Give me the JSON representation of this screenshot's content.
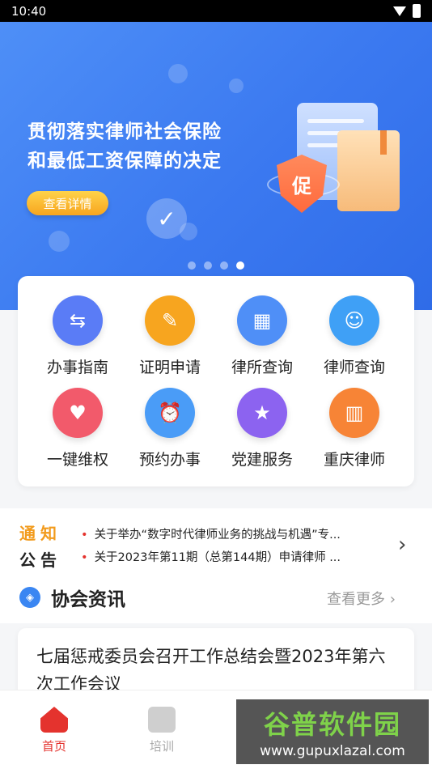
{
  "status": {
    "time": "10:40"
  },
  "banner": {
    "title_line1": "贯彻落实律师社会保险",
    "title_line2": "和最低工资保障的决定",
    "button": "查看详情",
    "shield_char": "促",
    "dots": 4,
    "active_dot": 4
  },
  "grid": [
    {
      "label": "办事指南",
      "icon": "signpost-icon",
      "color": "#5a7cf6"
    },
    {
      "label": "证明申请",
      "icon": "clipboard-edit-icon",
      "color": "#f7a51f"
    },
    {
      "label": "律所查询",
      "icon": "building-search-icon",
      "color": "#4f8ff7"
    },
    {
      "label": "律师查询",
      "icon": "person-search-icon",
      "color": "#3fa0f6"
    },
    {
      "label": "一键维权",
      "icon": "badge-shield-icon",
      "color": "#f25a6b"
    },
    {
      "label": "预约办事",
      "icon": "alarm-clock-icon",
      "color": "#4a9cf7"
    },
    {
      "label": "党建服务",
      "icon": "party-book-icon",
      "color": "#8c63f0"
    },
    {
      "label": "重庆律师",
      "icon": "columns-icon",
      "color": "#f78436"
    }
  ],
  "notice": {
    "logo_top": "通知",
    "logo_bottom": "公告",
    "items": [
      "关于举办“数字时代律师业务的挑战与机遇”专...",
      "关于2023年第11期（总第144期）申请律师 ..."
    ]
  },
  "section": {
    "title": "协会资讯",
    "more": "查看更多"
  },
  "news": {
    "title": "七届惩戒委员会召开工作总结会暨2023年第六次工作会议"
  },
  "tabs": [
    {
      "label": "首页",
      "active": true
    },
    {
      "label": "培训",
      "active": false
    }
  ],
  "watermark": {
    "line1": "谷普软件园",
    "line2": "www.gupuxlazal.com"
  },
  "colors": {
    "accent": "#e4332e",
    "banner": "#3b79f0",
    "notice_orange": "#f29b1d"
  }
}
